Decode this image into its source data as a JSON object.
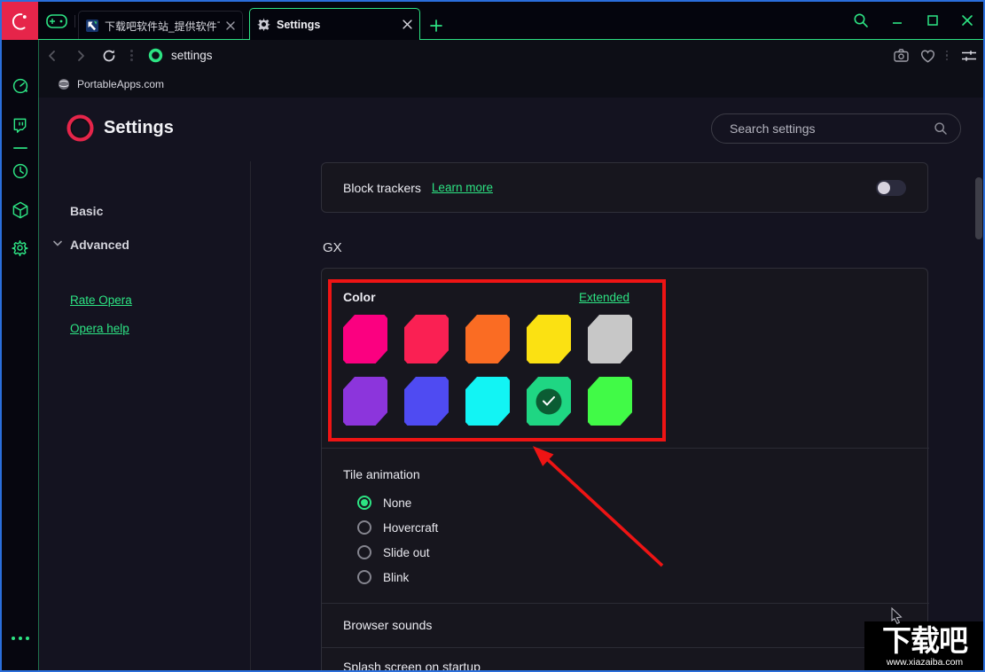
{
  "titlebar": {
    "tabs": [
      {
        "title": "下载吧软件站_提供软件下载",
        "active": false
      },
      {
        "title": "Settings",
        "active": true
      }
    ]
  },
  "toolbar": {
    "url": "settings"
  },
  "bookmarks_bar": {
    "label": "PortableApps.com"
  },
  "sidebar": {
    "icons": [
      "speed-dial",
      "twitch",
      "history-clock",
      "extensions-cube",
      "settings-gear",
      "more-ellipsis"
    ]
  },
  "settings": {
    "title": "Settings",
    "search_placeholder": "Search settings",
    "nav": {
      "basic": "Basic",
      "advanced": "Advanced",
      "rate_opera": "Rate Opera",
      "opera_help": "Opera help"
    },
    "block_trackers": {
      "label": "Block trackers",
      "link": "Learn more",
      "enabled": false
    },
    "gx": {
      "label": "GX",
      "color": {
        "label": "Color",
        "extended": "Extended",
        "swatches": [
          {
            "hex": "#fb0080",
            "selected": false
          },
          {
            "hex": "#fa2053",
            "selected": false
          },
          {
            "hex": "#fa6c23",
            "selected": false
          },
          {
            "hex": "#fbe112",
            "selected": false
          },
          {
            "hex": "#c7c7c7",
            "selected": false
          },
          {
            "hex": "#8c35dc",
            "selected": false
          },
          {
            "hex": "#4f4bf2",
            "selected": false
          },
          {
            "hex": "#12f4f4",
            "selected": false
          },
          {
            "hex": "#1fd683",
            "selected": true
          },
          {
            "hex": "#41fa47",
            "selected": false
          }
        ]
      },
      "tile_animation": {
        "label": "Tile animation",
        "options": [
          {
            "label": "None",
            "selected": true
          },
          {
            "label": "Hovercraft",
            "selected": false
          },
          {
            "label": "Slide out",
            "selected": false
          },
          {
            "label": "Blink",
            "selected": false
          }
        ]
      },
      "browser_sounds": {
        "label": "Browser sounds"
      },
      "splash_screen": {
        "label": "Splash screen on startup"
      }
    }
  },
  "annotation": {
    "watermark_title": "下载吧",
    "watermark_url": "www.xiazaiba.com"
  },
  "colors": {
    "accent_green": "#2de383",
    "logo_red": "#e6254a",
    "annotation_red": "#ee1414",
    "window_border_blue": "#2a6edb",
    "selected_check_bg": "#0b5c33"
  }
}
